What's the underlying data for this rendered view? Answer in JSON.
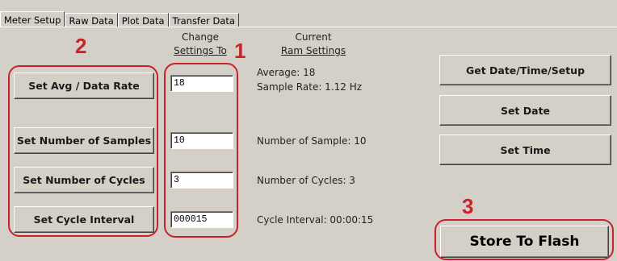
{
  "tabs": [
    {
      "label": "Meter Setup",
      "active": true
    },
    {
      "label": "Raw Data",
      "active": false
    },
    {
      "label": "Plot Data",
      "active": false
    },
    {
      "label": "Transfer Data",
      "active": false
    }
  ],
  "headers": {
    "change_line1": "Change",
    "change_line2": "Settings To",
    "current_line1": "Current",
    "current_line2": "Ram Settings"
  },
  "buttons": {
    "set_avg": "Set Avg / Data Rate",
    "set_samples": "Set Number of Samples",
    "set_cycles": "Set Number of Cycles",
    "set_interval": "Set Cycle Interval",
    "get_datetime": "Get Date/Time/Setup",
    "set_date": "Set Date",
    "set_time": "Set Time",
    "store_flash": "Store To Flash"
  },
  "inputs": {
    "avg": "18",
    "samples": "10",
    "cycles": "3",
    "interval": "000015"
  },
  "current": {
    "average": "Average: 18",
    "sample_rate": "Sample Rate: 1.12 Hz",
    "samples": "Number of Sample: 10",
    "cycles": "Number of Cycles: 3",
    "interval": "Cycle Interval: 00:00:15"
  },
  "annotations": {
    "one": "1",
    "two": "2",
    "three": "3",
    "color": "#c8222b"
  }
}
